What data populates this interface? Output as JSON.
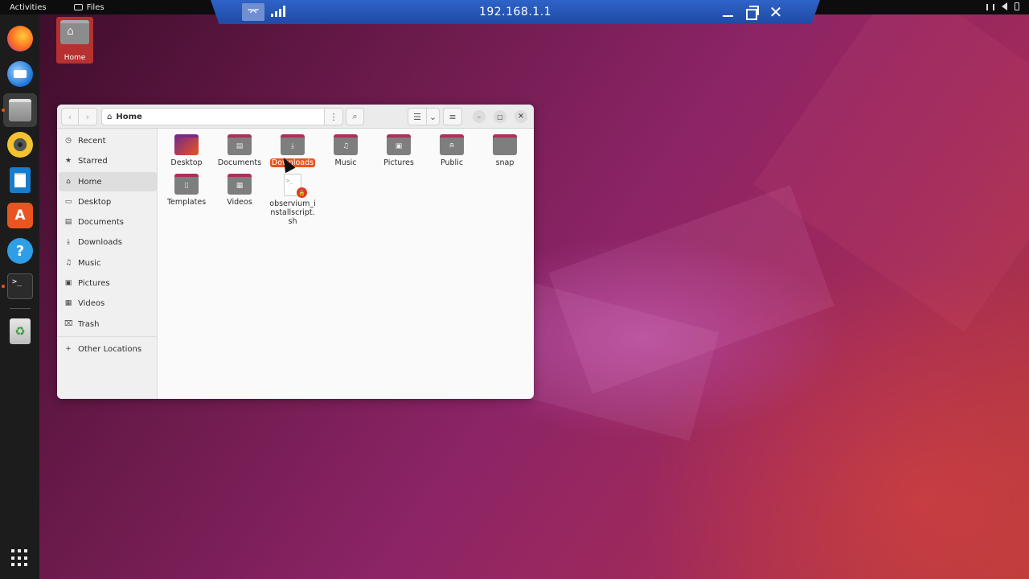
{
  "topbar": {
    "activities": "Activities",
    "app_name": "Files"
  },
  "remote": {
    "title": "192.168.1.1",
    "pin_label": "⌤"
  },
  "dock": {
    "software_glyph": "A",
    "help_glyph": "?",
    "terminal_glyph": ">_",
    "trash_glyph": "♻"
  },
  "desktop": {
    "home_label": "Home"
  },
  "window": {
    "path_label": "Home",
    "nav_back": "‹",
    "nav_fwd": "›",
    "path_menu": "⋮",
    "search": "⌕",
    "view_list": "☰",
    "view_opts": "⌄",
    "main_menu": "≡",
    "min": "–",
    "max": "▢",
    "close": "✕"
  },
  "sidebar": {
    "items": [
      {
        "label": "Recent",
        "icon": "◷"
      },
      {
        "label": "Starred",
        "icon": "★"
      },
      {
        "label": "Home",
        "icon": "⌂"
      },
      {
        "label": "Desktop",
        "icon": "▭"
      },
      {
        "label": "Documents",
        "icon": "▤"
      },
      {
        "label": "Downloads",
        "icon": "⤓"
      },
      {
        "label": "Music",
        "icon": "♫"
      },
      {
        "label": "Pictures",
        "icon": "▣"
      },
      {
        "label": "Videos",
        "icon": "▦"
      },
      {
        "label": "Trash",
        "icon": "⌧"
      }
    ],
    "other": {
      "label": "Other Locations",
      "icon": "+"
    }
  },
  "files": [
    {
      "name": "Desktop",
      "glyph": ""
    },
    {
      "name": "Documents",
      "glyph": "▤"
    },
    {
      "name": "Downloads",
      "glyph": "⤓"
    },
    {
      "name": "Music",
      "glyph": "♫"
    },
    {
      "name": "Pictures",
      "glyph": "▣"
    },
    {
      "name": "Public",
      "glyph": "≘"
    },
    {
      "name": "snap",
      "glyph": ""
    },
    {
      "name": "Templates",
      "glyph": "▯"
    },
    {
      "name": "Videos",
      "glyph": "▦"
    },
    {
      "name": "observium_installscript.sh",
      "glyph": ">_"
    }
  ],
  "colors": {
    "accent": "#e95420",
    "topbar": "#0d0d0d",
    "dock": "#1c1c1c",
    "rdp_bar": "#2f63c8"
  }
}
